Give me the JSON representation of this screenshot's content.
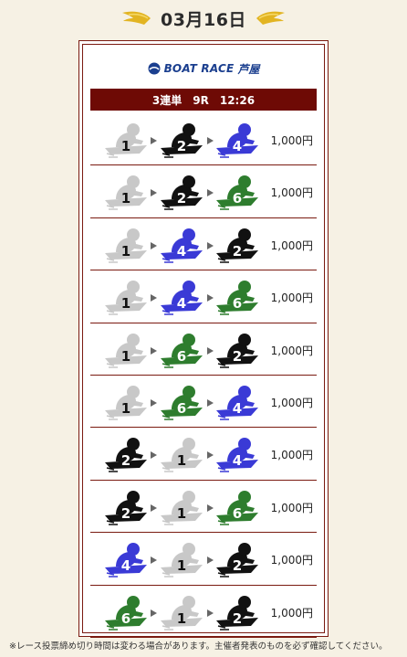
{
  "header": {
    "date": "03月16日"
  },
  "logo": {
    "text": "BOAT RACE",
    "venue": "芦屋"
  },
  "race": {
    "label": "3連単　9R　12:26"
  },
  "colors": {
    "1": "#c8c8c8",
    "2": "#111111",
    "4": "#3a3ad6",
    "6": "#2e7d2e",
    "accent": "#6e0a05"
  },
  "rows": [
    {
      "boats": [
        "1",
        "2",
        "4"
      ],
      "price": "1,000円"
    },
    {
      "boats": [
        "1",
        "2",
        "6"
      ],
      "price": "1,000円"
    },
    {
      "boats": [
        "1",
        "4",
        "2"
      ],
      "price": "1,000円"
    },
    {
      "boats": [
        "1",
        "4",
        "6"
      ],
      "price": "1,000円"
    },
    {
      "boats": [
        "1",
        "6",
        "2"
      ],
      "price": "1,000円"
    },
    {
      "boats": [
        "1",
        "6",
        "4"
      ],
      "price": "1,000円"
    },
    {
      "boats": [
        "2",
        "1",
        "4"
      ],
      "price": "1,000円"
    },
    {
      "boats": [
        "2",
        "1",
        "6"
      ],
      "price": "1,000円"
    },
    {
      "boats": [
        "4",
        "1",
        "2"
      ],
      "price": "1,000円"
    },
    {
      "boats": [
        "6",
        "1",
        "2"
      ],
      "price": "1,000円"
    }
  ],
  "footer": {
    "note": "※レース投票締め切り時間は変わる場合があります。主催者発表のものを必ず確認してください。"
  }
}
